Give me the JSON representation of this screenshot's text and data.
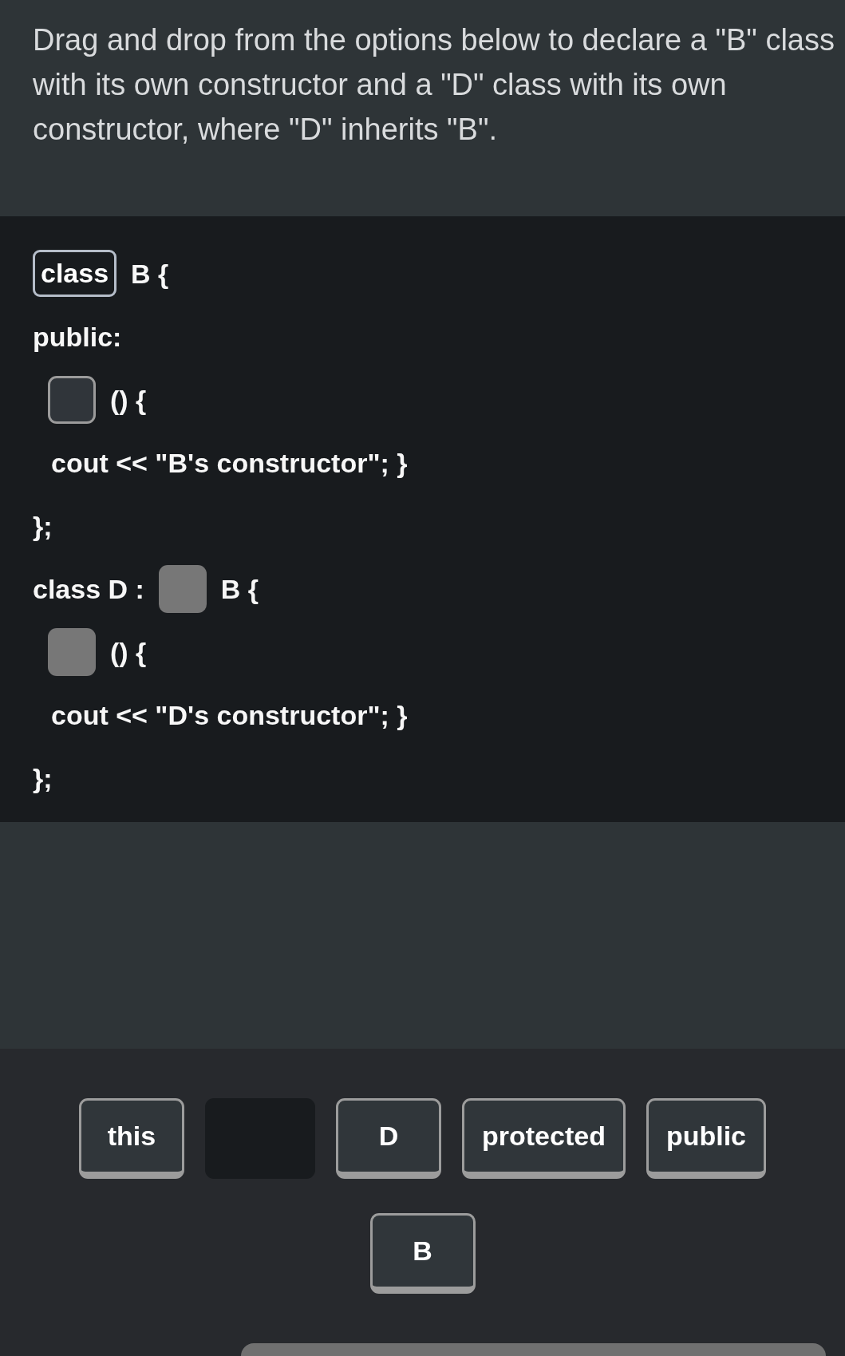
{
  "prompt": "Drag and drop from the options below to declare a \"B\" class with its own constructor and a \"D\" class with its own constructor, where \"D\" inherits \"B\".",
  "code_lines": [
    {
      "kind": "plain",
      "parts": [
        {
          "kind": "slot",
          "value": "class",
          "selected": false
        },
        {
          "kind": "text",
          "text": "B {"
        }
      ]
    },
    {
      "kind": "plain",
      "parts": [
        {
          "kind": "text",
          "text": "public:"
        }
      ]
    },
    {
      "kind": "member",
      "parts": [
        {
          "kind": "slot",
          "selected": true
        },
        {
          "kind": "text",
          "text": "() {"
        }
      ]
    },
    {
      "kind": "body",
      "parts": [
        {
          "kind": "text",
          "text": "cout << \"B's constructor\"; }"
        }
      ]
    },
    {
      "kind": "plain",
      "parts": [
        {
          "kind": "text",
          "text": "};"
        }
      ]
    },
    {
      "kind": "plain",
      "parts": [
        {
          "kind": "text",
          "text": "class D :"
        },
        {
          "kind": "slot",
          "selected": false
        },
        {
          "kind": "text",
          "text": "B {"
        }
      ]
    },
    {
      "kind": "member",
      "parts": [
        {
          "kind": "slot",
          "selected": false
        },
        {
          "kind": "text",
          "text": "() {"
        }
      ]
    },
    {
      "kind": "body",
      "parts": [
        {
          "kind": "text",
          "text": "cout << \"D's constructor\"; }"
        }
      ]
    },
    {
      "kind": "plain",
      "parts": [
        {
          "kind": "text",
          "text": "};"
        }
      ]
    }
  ],
  "options": [
    {
      "label": "this",
      "used": false
    },
    {
      "used": true
    },
    {
      "label": "D",
      "used": false
    },
    {
      "label": "protected",
      "used": false
    },
    {
      "label": "public",
      "used": false
    },
    {
      "label": "B",
      "used": false
    }
  ]
}
